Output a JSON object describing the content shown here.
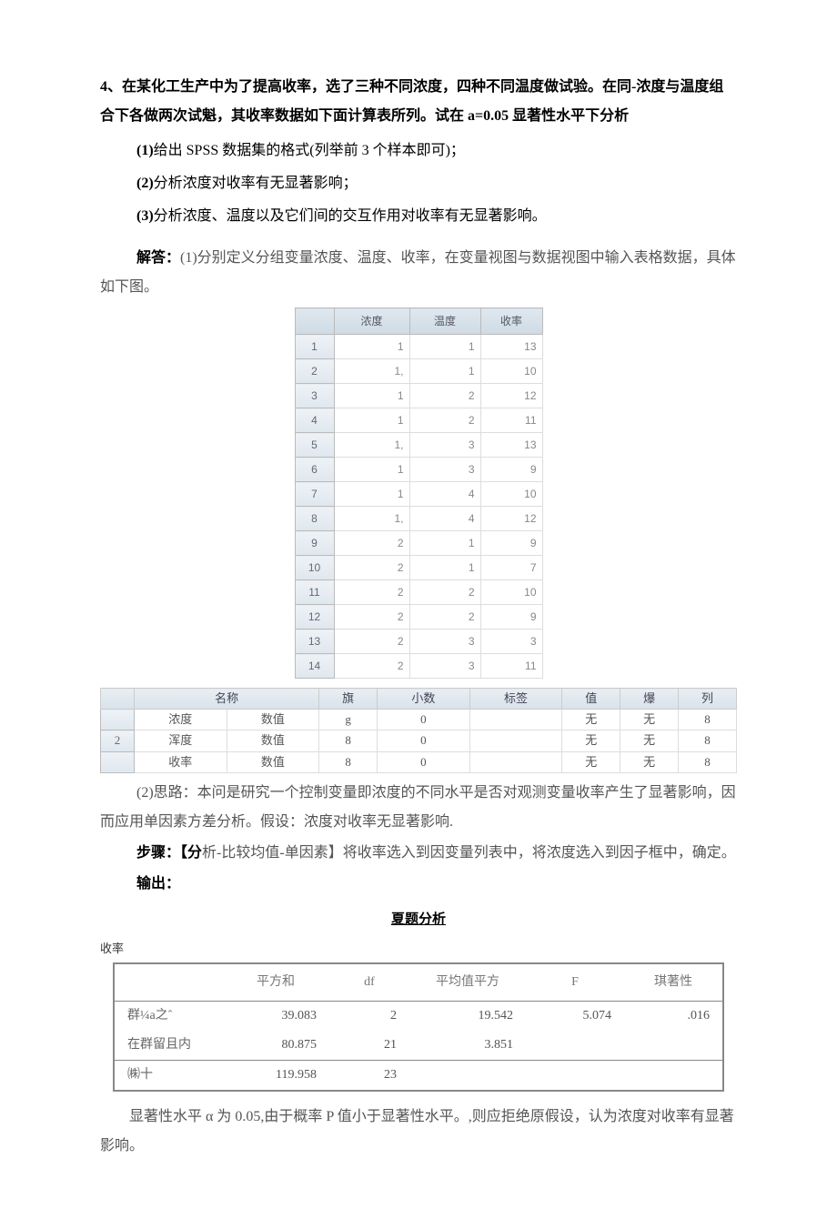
{
  "problem": {
    "num": "4",
    "intro": "、在某化工生产中为了提高收率，选了三种不同浓度，四种不同温度做试验。在同-浓度与温度组合下各做两次试魁，其收率数据如下面计算表所列。试在 a=0.05 显著性水平下分析",
    "q1_pre": "(1)",
    "q1": "给出 SPSS 数据集的格式(列举前 3 个样本即可)；",
    "q2_pre": "(2)",
    "q2": "分析浓度对收率有无显著影响；",
    "q3_pre": "(3)",
    "q3": "分析浓度、温度以及它们间的交互作用对收率有无显著影响。"
  },
  "answer": {
    "label": "解答：",
    "p1_pre": "(1)",
    "p1": "分别定义分组变量浓度、温度、收率，在变量视图与数据视图中输入表格数据，具体如下图。"
  },
  "spss": {
    "headers": [
      "浓度",
      "温度",
      "收率"
    ],
    "rows": [
      {
        "n": "1",
        "a": "1",
        "b": "1",
        "c": "13"
      },
      {
        "n": "2",
        "a": "1,",
        "b": "1",
        "c": "10"
      },
      {
        "n": "3",
        "a": "1",
        "b": "2",
        "c": "12"
      },
      {
        "n": "4",
        "a": "1",
        "b": "2",
        "c": "11"
      },
      {
        "n": "5",
        "a": "1,",
        "b": "3",
        "c": "13"
      },
      {
        "n": "6",
        "a": "1",
        "b": "3",
        "c": "9"
      },
      {
        "n": "7",
        "a": "1",
        "b": "4",
        "c": "10"
      },
      {
        "n": "8",
        "a": "1,",
        "b": "4",
        "c": "12"
      },
      {
        "n": "9",
        "a": "2",
        "b": "1",
        "c": "9"
      },
      {
        "n": "10",
        "a": "2",
        "b": "1",
        "c": "7"
      },
      {
        "n": "11",
        "a": "2",
        "b": "2",
        "c": "10"
      },
      {
        "n": "12",
        "a": "2",
        "b": "2",
        "c": "9"
      },
      {
        "n": "13",
        "a": "2",
        "b": "3",
        "c": "3"
      },
      {
        "n": "14",
        "a": "2",
        "b": "3",
        "c": "11"
      }
    ]
  },
  "varview": {
    "headers": [
      "",
      "名称",
      "",
      "旗",
      "小数",
      "标签",
      "值",
      "爆",
      "列"
    ],
    "rows": [
      {
        "n": "",
        "name": "浓度",
        "type": "数值",
        "w": "g",
        "dec": "0",
        "lab": "",
        "val": "无",
        "miss": "无",
        "col": "8"
      },
      {
        "n": "2",
        "name": "浑度",
        "type": "数值",
        "w": "8",
        "dec": "0",
        "lab": "",
        "val": "无",
        "miss": "无",
        "col": "8"
      },
      {
        "n": "",
        "name": "收率",
        "type": "数值",
        "w": "8",
        "dec": "0",
        "lab": "",
        "val": "无",
        "miss": "无",
        "col": "8"
      }
    ]
  },
  "part2": {
    "pre": "(2)",
    "idea_label": "思路：",
    "idea": "本问是研究一个控制变量即浓度的不同水平是否对观测变量收率产生了显著影响，因而应用单因素方差分析。假设：浓度对收率无显著影响.",
    "steps_label": "步骤：",
    "steps": "【分析-比较均值-单因素】将收率选入到因变量列表中，将浓度选入到因子框中，确定。",
    "output_label": "输出："
  },
  "anova": {
    "title": "夏题分析",
    "sub": "收率",
    "headers": [
      "",
      "平方和",
      "df",
      "平均值平方",
      "F",
      "琪著性"
    ],
    "rows": [
      {
        "lab": "群¼a之ˆ",
        "ss": "39.083",
        "df": "2",
        "ms": "19.542",
        "f": "5.074",
        "sig": ".016"
      },
      {
        "lab": "在群留且内",
        "ss": "80.875",
        "df": "21",
        "ms": "3.851",
        "f": "",
        "sig": ""
      },
      {
        "lab": "㈱十",
        "ss": "119.958",
        "df": "23",
        "ms": "",
        "f": "",
        "sig": ""
      }
    ]
  },
  "conclusion": "显著性水平 α 为 0.05,由于概率 P 值小于显著性水平。,则应拒绝原假设，认为浓度对收率有显著影响。"
}
